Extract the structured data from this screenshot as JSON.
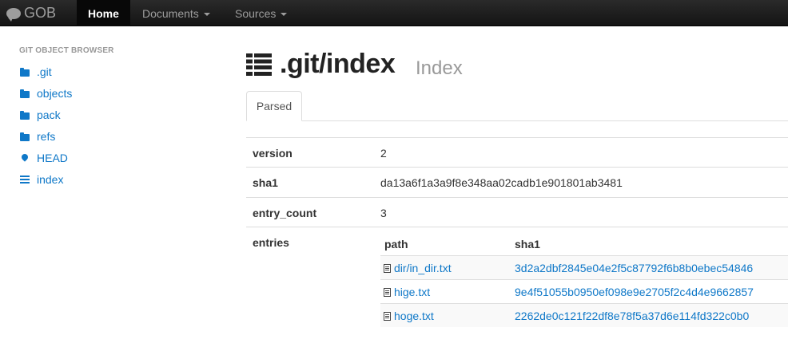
{
  "navbar": {
    "brand": "GOB",
    "items": [
      {
        "label": "Home",
        "active": true
      },
      {
        "label": "Documents",
        "dropdown": true
      },
      {
        "label": "Sources",
        "dropdown": true
      }
    ]
  },
  "sidebar": {
    "header": "GIT OBJECT BROWSER",
    "items": [
      {
        "label": ".git",
        "icon": "folder-open-icon"
      },
      {
        "label": "objects",
        "icon": "folder-open-icon"
      },
      {
        "label": "pack",
        "icon": "folder-open-icon"
      },
      {
        "label": "refs",
        "icon": "folder-open-icon"
      },
      {
        "label": "HEAD",
        "icon": "map-marker-icon"
      },
      {
        "label": "index",
        "icon": "list-icon"
      }
    ]
  },
  "page": {
    "title": ".git/index",
    "subtitle": "Index",
    "title_icon": "list-icon"
  },
  "tabs": [
    {
      "label": "Parsed",
      "active": true
    }
  ],
  "details": [
    {
      "key": "version",
      "value": "2"
    },
    {
      "key": "sha1",
      "value": "da13a6f1a3a9f8e348aa02cadb1e901801ab3481"
    },
    {
      "key": "entry_count",
      "value": "3"
    },
    {
      "key": "entries",
      "value": ""
    }
  ],
  "entries": {
    "columns": [
      "path",
      "sha1"
    ],
    "rows": [
      {
        "path": "dir/in_dir.txt",
        "sha1": "3d2a2dbf2845e04e2f5c87792f6b8b0ebec54846"
      },
      {
        "path": "hige.txt",
        "sha1": "9e4f51055b0950ef098e9e2705f2c4d4e9662857"
      },
      {
        "path": "hoge.txt",
        "sha1": "2262de0c121f22df8e78f5a37d6e114fd322c0b0"
      }
    ]
  },
  "colors": {
    "navbar": "#1b1b1b",
    "link": "#0f78c8",
    "muted": "#999999"
  }
}
